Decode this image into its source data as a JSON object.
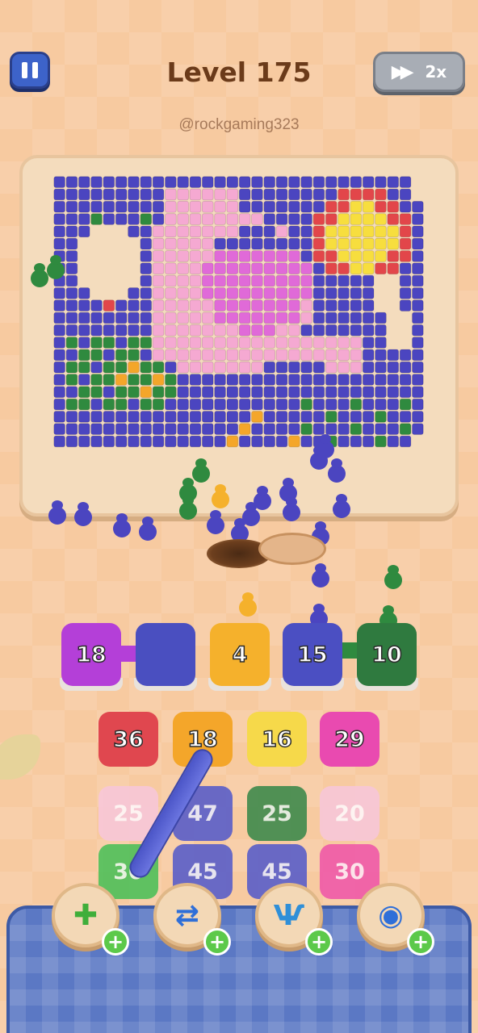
{
  "header": {
    "level_title": "Level 175",
    "username": "@rockgaming323",
    "speed_label": "2x"
  },
  "queue": [
    {
      "value": "18",
      "color": "#b43fd8"
    },
    {
      "value": "",
      "color": "#4a4fc0"
    },
    {
      "value": "4",
      "color": "#f5b12c"
    },
    {
      "value": "15",
      "color": "#4b4fc2"
    },
    {
      "value": "10",
      "color": "#2f7a3f"
    }
  ],
  "grid": {
    "rows": [
      [
        {
          "value": "36",
          "color": "#e0474f",
          "faded": false
        },
        {
          "value": "18",
          "color": "#f4a62a",
          "faded": false
        },
        {
          "value": "16",
          "color": "#f6d94a",
          "faded": false
        },
        {
          "value": "29",
          "color": "#e94ab0",
          "faded": false
        }
      ],
      [
        {
          "value": "25",
          "color": "#f7c7d8",
          "faded": true
        },
        {
          "value": "47",
          "color": "#5a5ec8",
          "faded": true
        },
        {
          "value": "25",
          "color": "#3f8a4c",
          "faded": true
        },
        {
          "value": "20",
          "color": "#f7c7d8",
          "faded": true
        }
      ],
      [
        {
          "value": "30",
          "color": "#4fc05a",
          "faded": true
        },
        {
          "value": "45",
          "color": "#5a5ec8",
          "faded": true
        },
        {
          "value": "45",
          "color": "#5a5ec8",
          "faded": true
        },
        {
          "value": "30",
          "color": "#f05aa8",
          "faded": true
        }
      ]
    ]
  },
  "powerups": [
    {
      "icon": "add-tray-icon"
    },
    {
      "icon": "shuffle-icon"
    },
    {
      "icon": "claw-icon"
    },
    {
      "icon": "magnet-icon"
    }
  ],
  "colors": {
    "purple": "#4b45c0",
    "pink": "#f5a9d2",
    "magenta": "#e06ad8",
    "red": "#e2464a",
    "yellow": "#f7de3e",
    "green": "#2f8a3f",
    "orange": "#f4a62a",
    "cream": "#f4dcbd"
  }
}
